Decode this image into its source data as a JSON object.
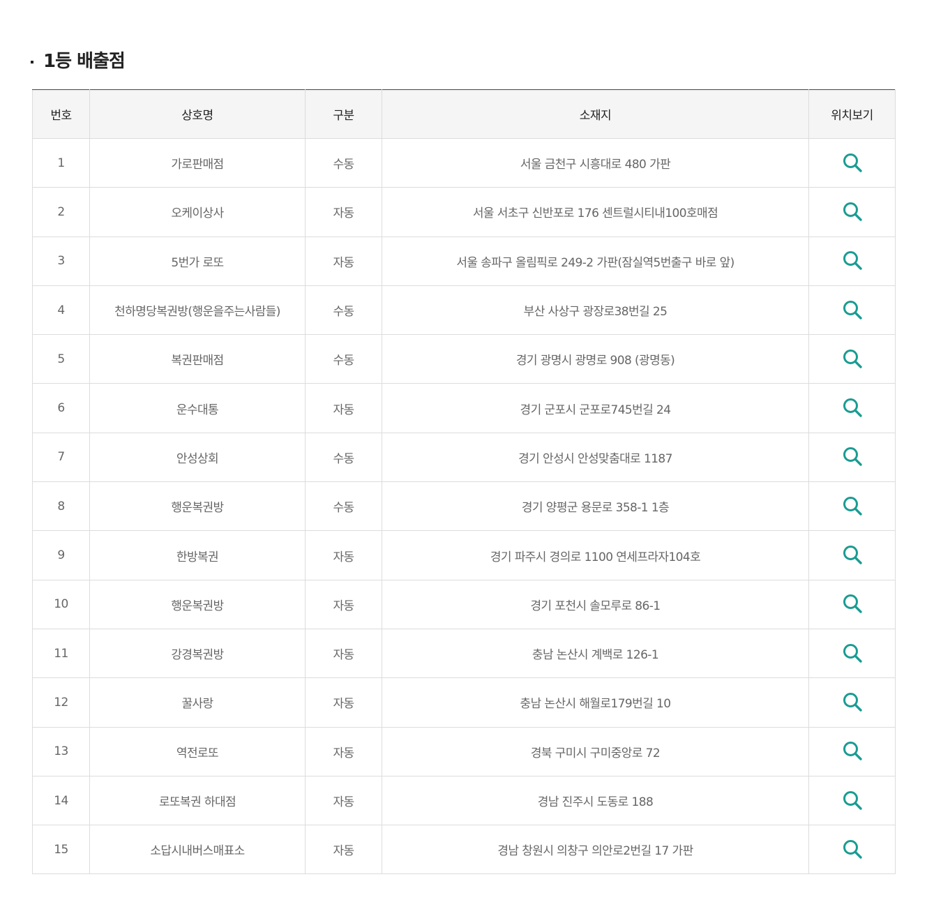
{
  "title": "1등 배출점",
  "columns": [
    "번호",
    "상호명",
    "구분",
    "소재지",
    "위치보기"
  ],
  "icon": {
    "name": "search-icon",
    "color": "#1a9c92"
  },
  "rows": [
    {
      "no": "1",
      "name": "가로판매점",
      "type": "수동",
      "address": "서울 금천구 시흥대로 480 가판"
    },
    {
      "no": "2",
      "name": "오케이상사",
      "type": "자동",
      "address": "서울 서초구 신반포로 176 센트럴시티내100호매점"
    },
    {
      "no": "3",
      "name": "5번가 로또",
      "type": "자동",
      "address": "서울 송파구 올림픽로 249-2 가판(잠실역5번출구 바로 앞)"
    },
    {
      "no": "4",
      "name": "천하명당복권방(행운을주는사람들)",
      "type": "수동",
      "address": "부산 사상구 광장로38번길 25"
    },
    {
      "no": "5",
      "name": "복권판매점",
      "type": "수동",
      "address": "경기 광명시 광명로 908 (광명동)"
    },
    {
      "no": "6",
      "name": "운수대통",
      "type": "자동",
      "address": "경기 군포시 군포로745번길 24"
    },
    {
      "no": "7",
      "name": "안성상회",
      "type": "수동",
      "address": "경기 안성시 안성맞춤대로 1187"
    },
    {
      "no": "8",
      "name": "행운복권방",
      "type": "수동",
      "address": "경기 양평군 용문로 358-1 1층"
    },
    {
      "no": "9",
      "name": "한방복권",
      "type": "자동",
      "address": "경기 파주시 경의로 1100 연세프라자104호"
    },
    {
      "no": "10",
      "name": "행운복권방",
      "type": "자동",
      "address": "경기 포천시 솔모루로 86-1"
    },
    {
      "no": "11",
      "name": "강경복권방",
      "type": "자동",
      "address": "충남 논산시 계백로 126-1"
    },
    {
      "no": "12",
      "name": "꿀사랑",
      "type": "자동",
      "address": "충남 논산시 해월로179번길 10"
    },
    {
      "no": "13",
      "name": "역전로또",
      "type": "자동",
      "address": "경북 구미시 구미중앙로 72"
    },
    {
      "no": "14",
      "name": "로또복권 하대점",
      "type": "자동",
      "address": "경남 진주시 도동로 188"
    },
    {
      "no": "15",
      "name": "소답시내버스매표소",
      "type": "자동",
      "address": "경남 창원시 의창구 의안로2번길 17 가판"
    }
  ]
}
